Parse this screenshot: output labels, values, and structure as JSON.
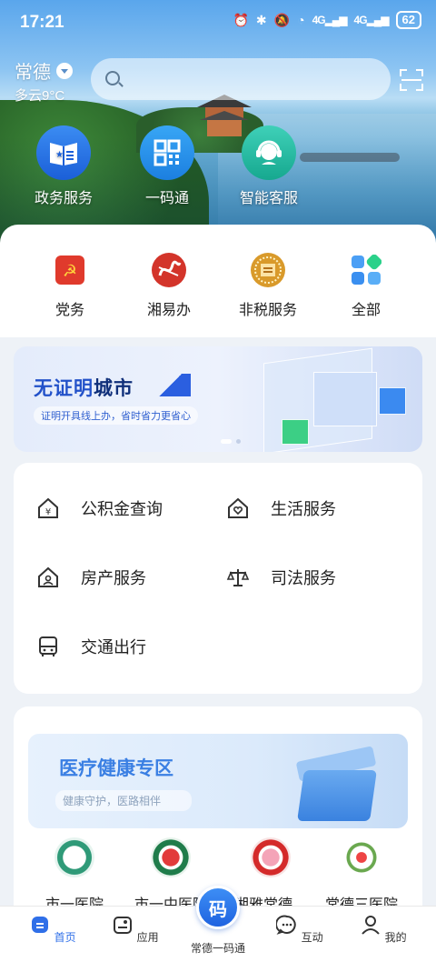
{
  "status_bar": {
    "time": "17:21",
    "signal1": "4G",
    "signal2": "4G",
    "battery": "62"
  },
  "location": {
    "city": "常德",
    "weather": "多云9°C"
  },
  "search": {
    "placeholder": ""
  },
  "hero_buttons": [
    {
      "label": "政务服务",
      "icon": "government-service-icon"
    },
    {
      "label": "一码通",
      "icon": "qr-code-icon"
    },
    {
      "label": "智能客服",
      "icon": "customer-service-icon"
    }
  ],
  "quick_links": [
    {
      "label": "党务",
      "icon": "party-emblem-icon"
    },
    {
      "label": "湘易办",
      "icon": "xiangyiban-icon"
    },
    {
      "label": "非税服务",
      "icon": "non-tax-service-icon"
    },
    {
      "label": "全部",
      "icon": "all-apps-icon"
    }
  ],
  "banner": {
    "title_a": "无证明",
    "title_b": "城市",
    "subtitle": "证明开具线上办，省时省力更省心",
    "pages": 2,
    "active_page": 1
  },
  "services": [
    {
      "label": "公积金查询",
      "icon": "housing-fund-icon"
    },
    {
      "label": "生活服务",
      "icon": "life-service-icon"
    },
    {
      "label": "房产服务",
      "icon": "property-service-icon"
    },
    {
      "label": "司法服务",
      "icon": "justice-scale-icon"
    },
    {
      "label": "交通出行",
      "icon": "bus-icon"
    }
  ],
  "medical": {
    "title": "医疗健康专区",
    "subtitle": "健康守护，医路相伴",
    "hospitals": [
      {
        "label": "市一医院"
      },
      {
        "label": "市一中医院"
      },
      {
        "label": "湘雅常德…"
      },
      {
        "label": "常德三医院"
      }
    ]
  },
  "nav": {
    "items": [
      {
        "label": "首页",
        "icon": "home-icon"
      },
      {
        "label": "应用",
        "icon": "apps-icon"
      },
      {
        "label": "常德一码通",
        "icon": "code-icon"
      },
      {
        "label": "互动",
        "icon": "chat-icon"
      },
      {
        "label": "我的",
        "icon": "profile-icon"
      }
    ],
    "fab_label": "码",
    "active": "首页"
  },
  "colors": {
    "accent": "#2f6fe8",
    "banner_title": "#2251c9",
    "medical_title": "#3a7fe3"
  }
}
